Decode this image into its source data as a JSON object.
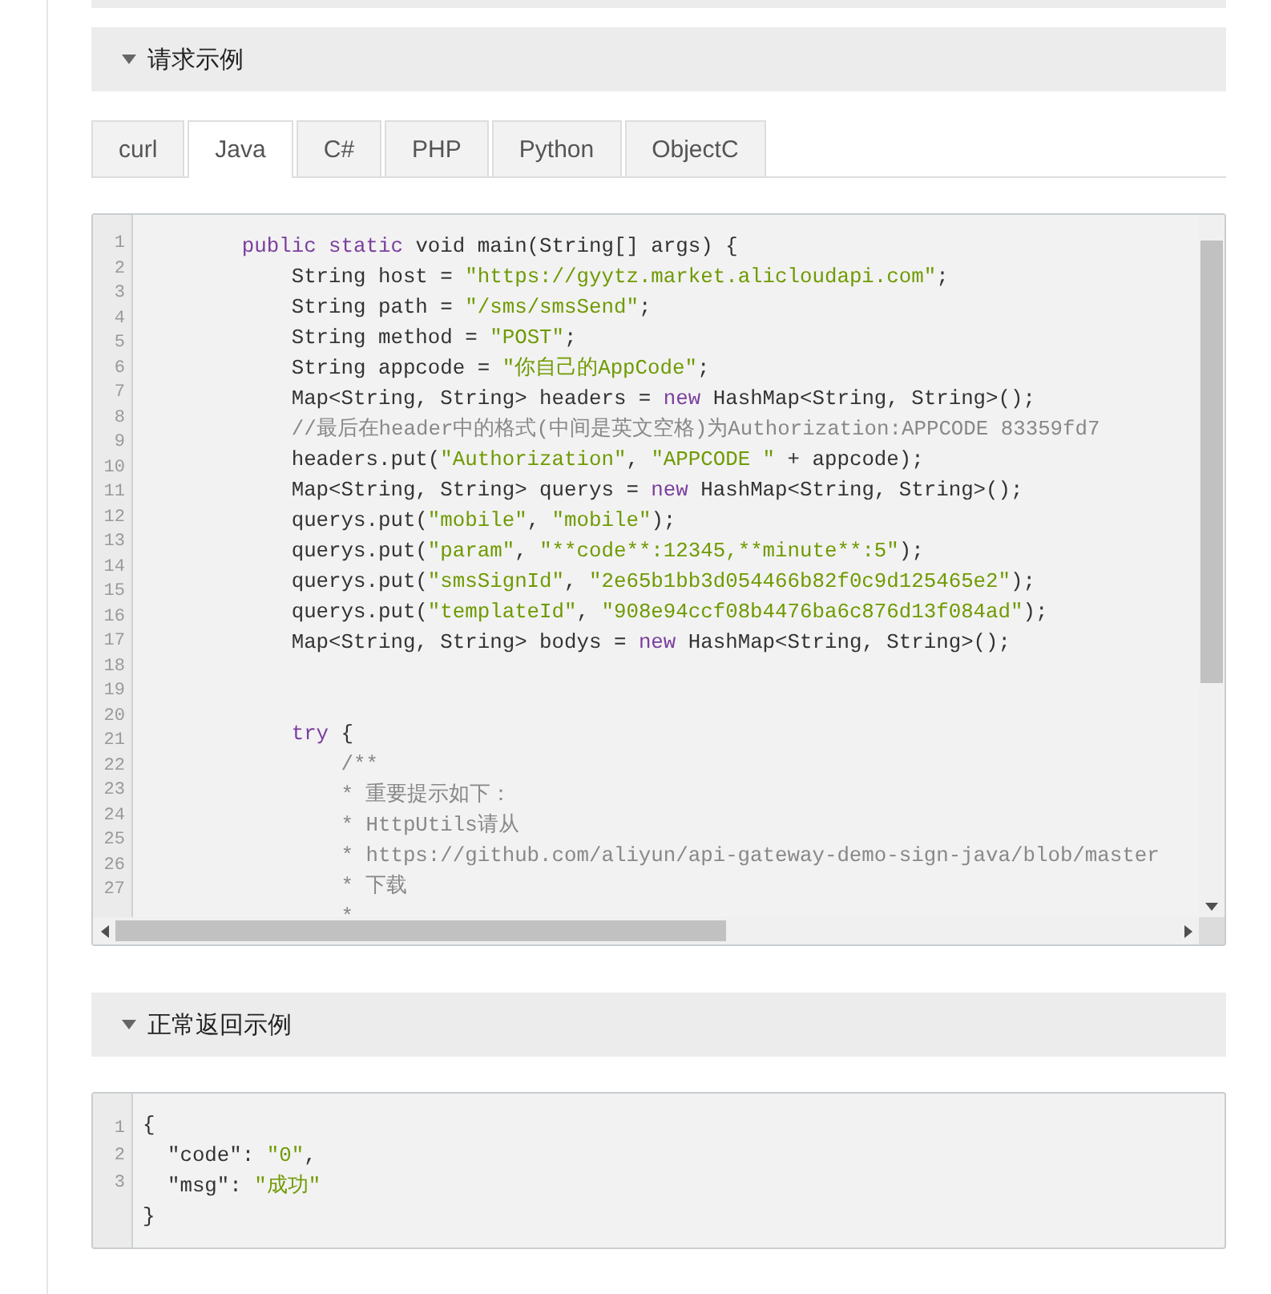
{
  "sections": [
    {
      "title": "请求示例",
      "expanded": true,
      "tabs": [
        {
          "label": "curl",
          "selected": false
        },
        {
          "label": "Java",
          "selected": true
        },
        {
          "label": "C#",
          "selected": false
        },
        {
          "label": "PHP",
          "selected": false
        },
        {
          "label": "Python",
          "selected": false
        },
        {
          "label": "ObjectC",
          "selected": false
        }
      ],
      "code": {
        "scrollbars": true,
        "line_numbers": [
          "1",
          "2",
          "3",
          "4",
          "5",
          "6",
          "7",
          "8",
          "9",
          "10",
          "11",
          "12",
          "13",
          "14",
          "15",
          "16",
          "17",
          "18",
          "19",
          "20",
          "21",
          "22",
          "23",
          "24",
          "25",
          "26",
          "27"
        ],
        "lines": [
          {
            "kind": "code",
            "tokens": [
              {
                "kind": "keyword",
                "text": "        public static"
              },
              {
                "kind": "plain",
                "text": " void main(String[] args) {"
              }
            ]
          },
          {
            "kind": "code",
            "tokens": [
              {
                "kind": "plain",
                "text": "            String host = "
              },
              {
                "kind": "string",
                "text": "\"https://gyytz.market.alicloudapi.com\""
              },
              {
                "kind": "plain",
                "text": ";"
              }
            ]
          },
          {
            "kind": "code",
            "tokens": [
              {
                "kind": "plain",
                "text": "            String path = "
              },
              {
                "kind": "string",
                "text": "\"/sms/smsSend\""
              },
              {
                "kind": "plain",
                "text": ";"
              }
            ]
          },
          {
            "kind": "code",
            "tokens": [
              {
                "kind": "plain",
                "text": "            String method = "
              },
              {
                "kind": "string",
                "text": "\"POST\""
              },
              {
                "kind": "plain",
                "text": ";"
              }
            ]
          },
          {
            "kind": "code",
            "tokens": [
              {
                "kind": "plain",
                "text": "            String appcode = "
              },
              {
                "kind": "string",
                "text": "\"你自己的AppCode\""
              },
              {
                "kind": "plain",
                "text": ";"
              }
            ]
          },
          {
            "kind": "code",
            "tokens": [
              {
                "kind": "plain",
                "text": "            Map<String, String> headers = "
              },
              {
                "kind": "keyword",
                "text": "new"
              },
              {
                "kind": "plain",
                "text": " HashMap<String, String>();"
              }
            ]
          },
          {
            "kind": "code",
            "tokens": [
              {
                "kind": "comment",
                "text": "            //最后在header中的格式(中间是英文空格)为Authorization:APPCODE 83359fd7"
              }
            ]
          },
          {
            "kind": "code",
            "tokens": [
              {
                "kind": "plain",
                "text": "            headers.put("
              },
              {
                "kind": "string",
                "text": "\"Authorization\""
              },
              {
                "kind": "plain",
                "text": ", "
              },
              {
                "kind": "string",
                "text": "\"APPCODE \""
              },
              {
                "kind": "plain",
                "text": " + appcode);"
              }
            ]
          },
          {
            "kind": "code",
            "tokens": [
              {
                "kind": "plain",
                "text": "            Map<String, String> querys = "
              },
              {
                "kind": "keyword",
                "text": "new"
              },
              {
                "kind": "plain",
                "text": " HashMap<String, String>();"
              }
            ]
          },
          {
            "kind": "code",
            "tokens": [
              {
                "kind": "plain",
                "text": "            querys.put("
              },
              {
                "kind": "string",
                "text": "\"mobile\""
              },
              {
                "kind": "plain",
                "text": ", "
              },
              {
                "kind": "string",
                "text": "\"mobile\""
              },
              {
                "kind": "plain",
                "text": ");"
              }
            ]
          },
          {
            "kind": "code",
            "tokens": [
              {
                "kind": "plain",
                "text": "            querys.put("
              },
              {
                "kind": "string",
                "text": "\"param\""
              },
              {
                "kind": "plain",
                "text": ", "
              },
              {
                "kind": "string",
                "text": "\"**code**:12345,**minute**:5\""
              },
              {
                "kind": "plain",
                "text": ");"
              }
            ]
          },
          {
            "kind": "code",
            "tokens": [
              {
                "kind": "plain",
                "text": "            querys.put("
              },
              {
                "kind": "string",
                "text": "\"smsSignId\""
              },
              {
                "kind": "plain",
                "text": ", "
              },
              {
                "kind": "string",
                "text": "\"2e65b1bb3d054466b82f0c9d125465e2\""
              },
              {
                "kind": "plain",
                "text": ");"
              }
            ]
          },
          {
            "kind": "code",
            "tokens": [
              {
                "kind": "plain",
                "text": "            querys.put("
              },
              {
                "kind": "string",
                "text": "\"templateId\""
              },
              {
                "kind": "plain",
                "text": ", "
              },
              {
                "kind": "string",
                "text": "\"908e94ccf08b4476ba6c876d13f084ad\""
              },
              {
                "kind": "plain",
                "text": ");"
              }
            ]
          },
          {
            "kind": "code",
            "tokens": [
              {
                "kind": "plain",
                "text": "            Map<String, String> bodys = "
              },
              {
                "kind": "keyword",
                "text": "new"
              },
              {
                "kind": "plain",
                "text": " HashMap<String, String>();"
              }
            ]
          },
          {
            "kind": "blank"
          },
          {
            "kind": "blank"
          },
          {
            "kind": "code",
            "tokens": [
              {
                "kind": "keyword",
                "text": "            try"
              },
              {
                "kind": "plain",
                "text": " {"
              }
            ]
          },
          {
            "kind": "code",
            "tokens": [
              {
                "kind": "comment",
                "text": "                /**"
              }
            ]
          },
          {
            "kind": "code",
            "tokens": [
              {
                "kind": "comment",
                "text": "                * 重要提示如下："
              }
            ]
          },
          {
            "kind": "code",
            "tokens": [
              {
                "kind": "comment",
                "text": "                * HttpUtils请从"
              }
            ]
          },
          {
            "kind": "code",
            "tokens": [
              {
                "kind": "comment",
                "text": "                * https://github.com/aliyun/api-gateway-demo-sign-java/blob/master"
              }
            ]
          },
          {
            "kind": "code",
            "tokens": [
              {
                "kind": "comment",
                "text": "                * 下载"
              }
            ]
          },
          {
            "kind": "code",
            "tokens": [
              {
                "kind": "comment",
                "text": "                *"
              }
            ]
          }
        ]
      }
    },
    {
      "title": "正常返回示例",
      "expanded": true,
      "code": {
        "scrollbars": false,
        "line_numbers": [
          "1",
          "2",
          "3"
        ],
        "lines": [
          {
            "kind": "code",
            "tokens": [
              {
                "kind": "plain",
                "text": "{"
              }
            ]
          },
          {
            "kind": "code",
            "tokens": [
              {
                "kind": "plain",
                "text": "  \"code\": "
              },
              {
                "kind": "string",
                "text": "\"0\""
              },
              {
                "kind": "plain",
                "text": ","
              }
            ]
          },
          {
            "kind": "code",
            "tokens": [
              {
                "kind": "plain",
                "text": "  \"msg\": "
              },
              {
                "kind": "string",
                "text": "\"成功\""
              }
            ]
          },
          {
            "kind": "code",
            "tokens": [
              {
                "kind": "plain",
                "text": "}"
              }
            ]
          }
        ]
      }
    }
  ]
}
